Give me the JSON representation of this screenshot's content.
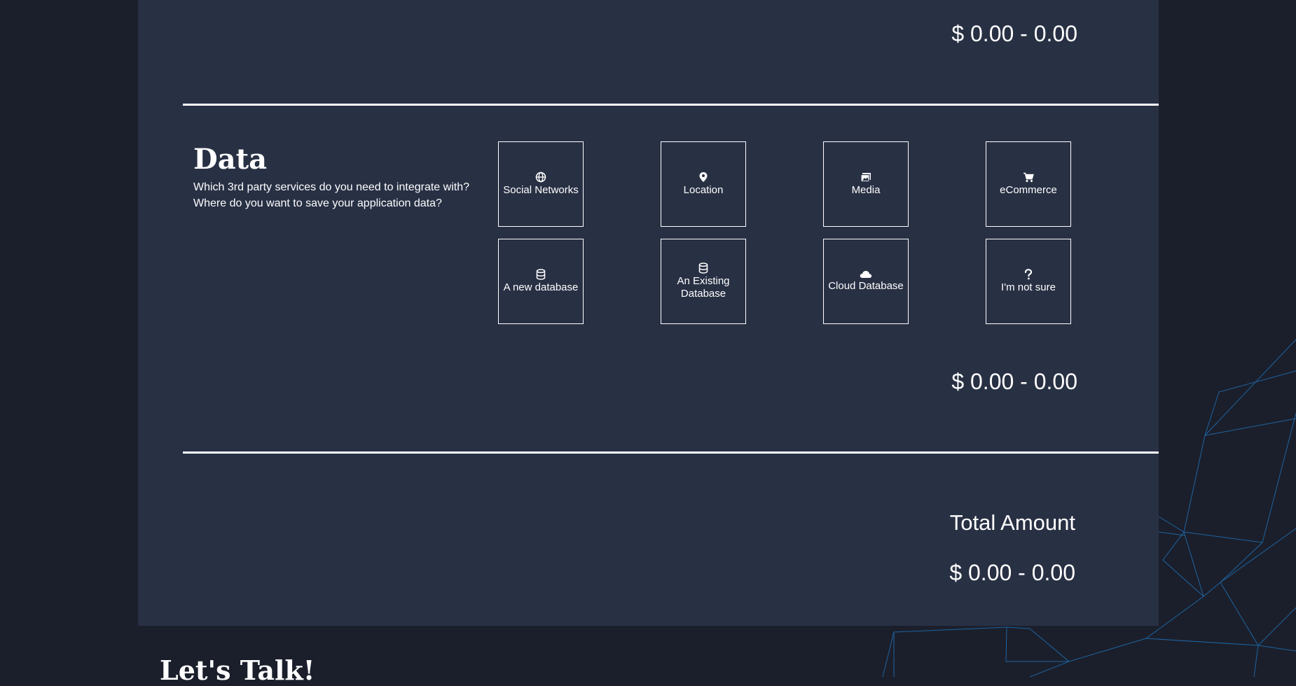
{
  "top_price": "$ 0.00 - 0.00",
  "data_section": {
    "title": "Data",
    "description_lines": [
      "Which 3rd party services do you need to integrate with?",
      "Where do you want to save your application data?"
    ],
    "options": [
      {
        "label": "Social Networks",
        "icon": "globe-icon"
      },
      {
        "label": "Location",
        "icon": "map-pin-icon"
      },
      {
        "label": "Media",
        "icon": "images-icon"
      },
      {
        "label": "eCommerce",
        "icon": "cart-icon"
      },
      {
        "label": "A new database",
        "icon": "database-icon"
      },
      {
        "label": "An Existing Database",
        "icon": "database-icon"
      },
      {
        "label": "Cloud Database",
        "icon": "cloud-icon"
      },
      {
        "label": "I'm not sure",
        "icon": "question-icon"
      }
    ],
    "price": "$ 0.00 - 0.00"
  },
  "total": {
    "label": "Total Amount",
    "value": "$ 0.00 - 0.00"
  },
  "footer": {
    "heading": "Let's Talk!"
  },
  "colors": {
    "page_background": "#1b1f2b",
    "panel_background": "#283044",
    "text": "#ffffff",
    "decor_lines": "#1e6fb5"
  }
}
